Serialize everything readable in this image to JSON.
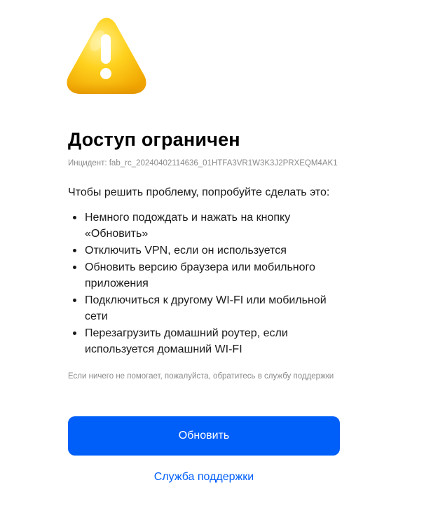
{
  "icon": {
    "name": "warning-icon",
    "colors": {
      "body_light": "#ffe25a",
      "body_mid": "#ffcc1a",
      "body_dark": "#f2a900",
      "mark": "#ffffff"
    }
  },
  "title": "Доступ ограничен",
  "incident": "Инцидент: fab_rc_20240402114636_01HTFA3VR1W3K3J2PRXEQM4AK1",
  "intro": "Чтобы решить проблему, попробуйте сделать это:",
  "steps": [
    {
      "line1": "Немного подождать и нажать на кнопку",
      "line2": "«Обновить»"
    },
    {
      "line1": "Отключить VPN, если он используется",
      "line2": ""
    },
    {
      "line1": "Обновить версию браузера или мобильного",
      "line2": "приложения"
    },
    {
      "line1": "Подключиться к другому WI-FI или мобильной",
      "line2": "сети"
    },
    {
      "line1": "Перезагрузить домашний роутер, если",
      "line2": "используется домашний WI-FI"
    }
  ],
  "help_note": "Если ничего не помогает, пожалуйста, обратитесь в службу поддержки",
  "buttons": {
    "refresh": "Обновить",
    "support": "Служба поддержки"
  },
  "colors": {
    "accent": "#005ff9",
    "muted_text": "#8a8a8a"
  }
}
